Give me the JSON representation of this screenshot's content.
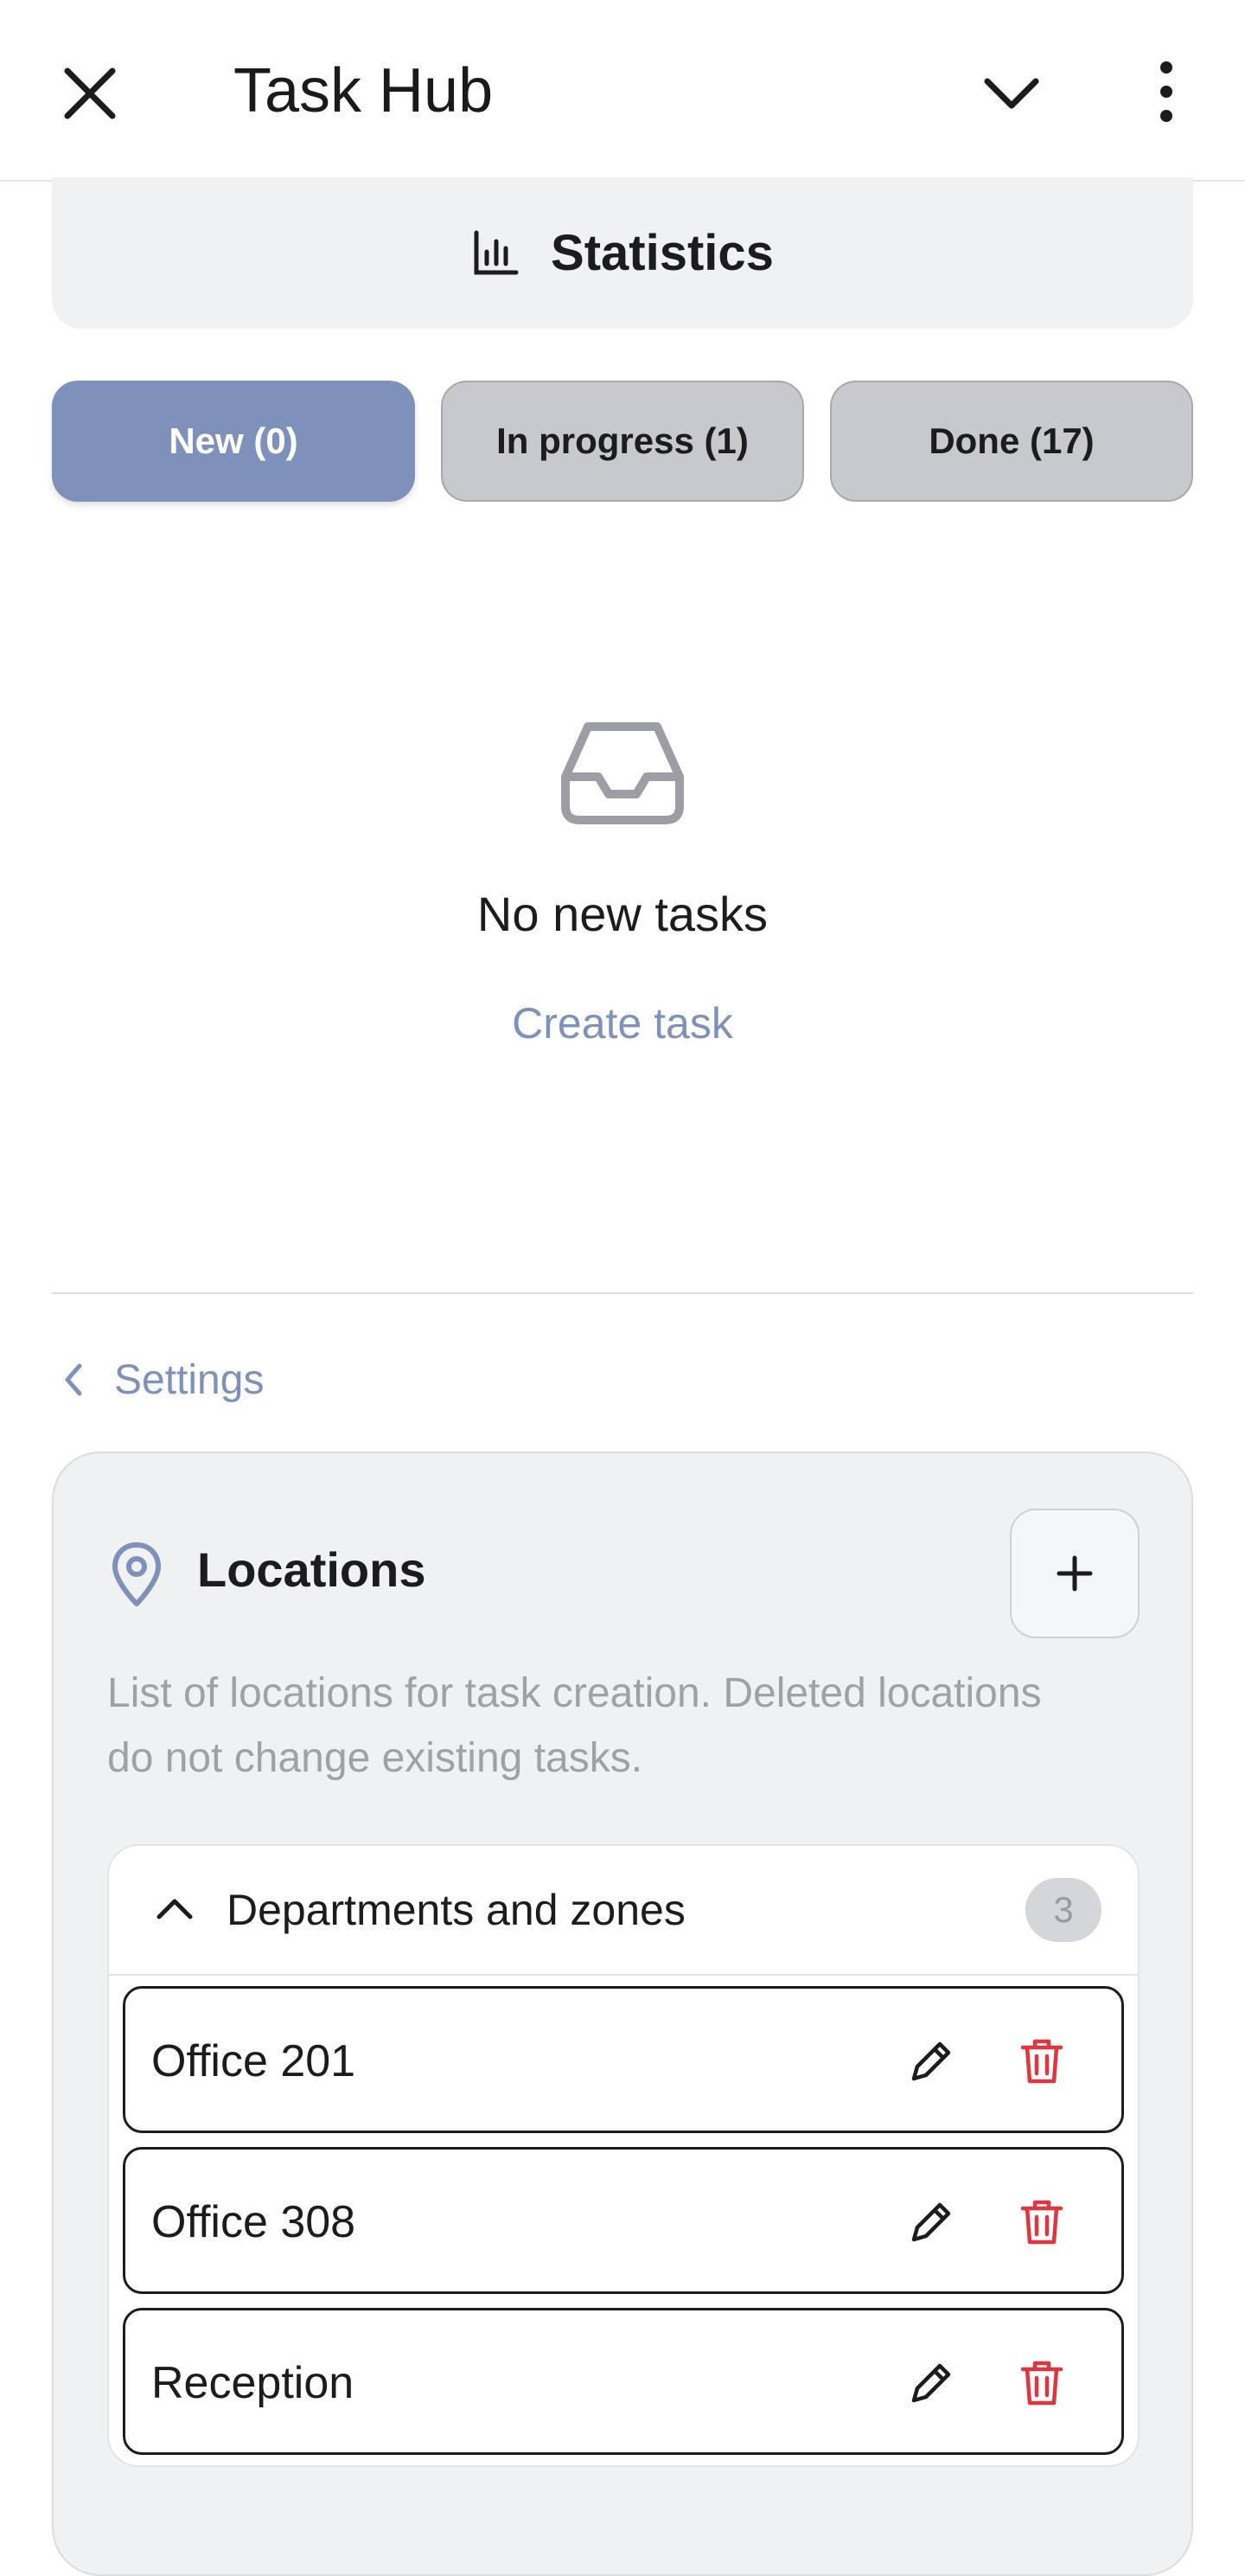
{
  "app_bar": {
    "title": "Task Hub",
    "close_icon": "close-icon",
    "collapse_icon": "chevron-down-icon",
    "menu_icon": "more-vert-icon"
  },
  "statistics": {
    "label": "Statistics",
    "icon": "bar-chart-icon"
  },
  "tabs": [
    {
      "label": "New (0)",
      "active": true
    },
    {
      "label": "In progress (1)",
      "active": false
    },
    {
      "label": "Done (17)",
      "active": false
    }
  ],
  "empty_state": {
    "icon": "inbox-icon",
    "title": "No new tasks",
    "action": "Create task"
  },
  "settings_link": {
    "label": "Settings",
    "icon": "chevron-left-icon"
  },
  "locations": {
    "icon": "location-pin-icon",
    "title": "Locations",
    "add_icon": "plus-icon",
    "description": "List of locations for task creation. Deleted locations do not change existing tasks.",
    "group": {
      "title": "Departments and zones",
      "count": "3",
      "expanded": true,
      "items": [
        {
          "name": "Office 201"
        },
        {
          "name": "Office 308"
        },
        {
          "name": "Reception"
        }
      ]
    }
  },
  "colors": {
    "accent": "#7e91bb",
    "danger": "#e0363f",
    "inactive_tab": "#c8c9cc",
    "card_bg": "#f0f1f3",
    "muted_text": "#a0a1a6"
  }
}
